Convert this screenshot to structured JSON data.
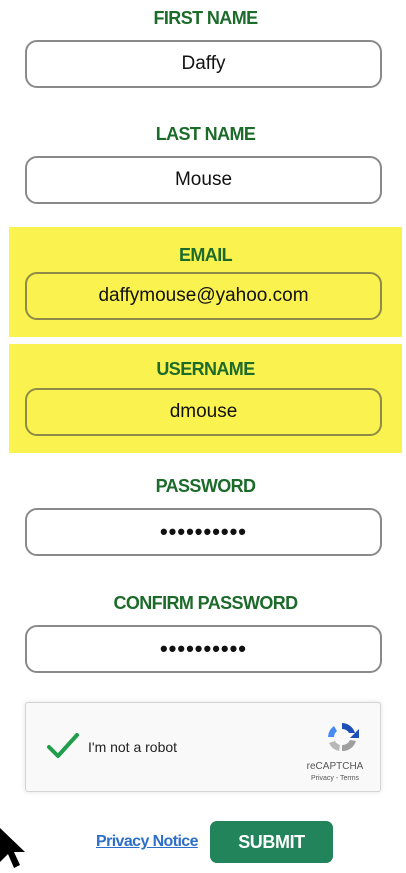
{
  "form": {
    "first_name": {
      "label": "FIRST NAME",
      "value": "Daffy"
    },
    "last_name": {
      "label": "LAST NAME",
      "value": "Mouse"
    },
    "email": {
      "label": "EMAIL",
      "value": "daffymouse@yahoo.com",
      "highlight": "#faf24f"
    },
    "username": {
      "label": "USERNAME",
      "value": "dmouse",
      "highlight": "#faf24f"
    },
    "password": {
      "label": "PASSWORD",
      "masked_value": "••••••••••"
    },
    "confirm_password": {
      "label": "CONFIRM PASSWORD",
      "masked_value": "••••••••••"
    }
  },
  "captcha": {
    "checkbox_state": "checked",
    "checkmark_icon": "green-checkmark-icon",
    "label": "I'm not a robot",
    "logo_icon": "recaptcha-logo-icon",
    "brand": "reCAPTCHA",
    "links": "Privacy - Terms"
  },
  "footer": {
    "privacy_link": "Privacy Notice",
    "submit_label": "SUBMIT"
  },
  "colors": {
    "label_green": "#1c6b2a",
    "highlight_yellow": "#faf24f",
    "submit_green": "#21845a",
    "link_blue": "#2d6fc8"
  }
}
